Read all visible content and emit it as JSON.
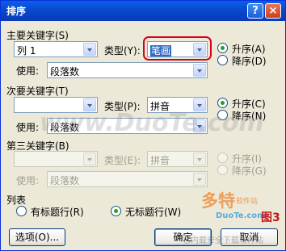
{
  "title": "排序",
  "titlebar": {
    "help_label": "?",
    "close_label": "×"
  },
  "key1": {
    "label": "主要关键字(S)",
    "column": "列 1",
    "type_label": "类型(Y):",
    "type_value": "笔画",
    "using_label": "使用:",
    "using_value": "段落数",
    "asc_label": "升序(A)",
    "desc_label": "降序(D)",
    "order": "asc"
  },
  "key2": {
    "label": "次要关键字(T)",
    "column": "",
    "type_label": "类型(P):",
    "type_value": "拼音",
    "using_label": "使用:",
    "using_value": "段落数",
    "asc_label": "升序(C)",
    "desc_label": "降序(N)",
    "order": "asc"
  },
  "key3": {
    "label": "第三关键字(B)",
    "column": "",
    "type_label": "类型(E):",
    "type_value": "拼音",
    "using_label": "使用:",
    "using_value": "段落数",
    "asc_label": "升序(I)",
    "desc_label": "降序(G)",
    "order": "asc"
  },
  "list": {
    "label": "列表",
    "header_row_label": "有标题行(R)",
    "no_header_row_label": "无标题行(W)",
    "selected": "no_header"
  },
  "buttons": {
    "options": "选项(O)...",
    "ok": "确定",
    "cancel": "取消"
  },
  "watermarks": {
    "center": "www.DuoTe.com",
    "logo_cn": "多特",
    "logo_small": "软件站",
    "logo_en": "DuoTe.com",
    "figure": "图3",
    "bottom": "它内载安全下载软件站"
  },
  "colors": {
    "title_bar": "#0A5FE8",
    "highlight": "#D9001B",
    "dialog_bg": "#ECE9D8",
    "selection": "#316AC5"
  }
}
